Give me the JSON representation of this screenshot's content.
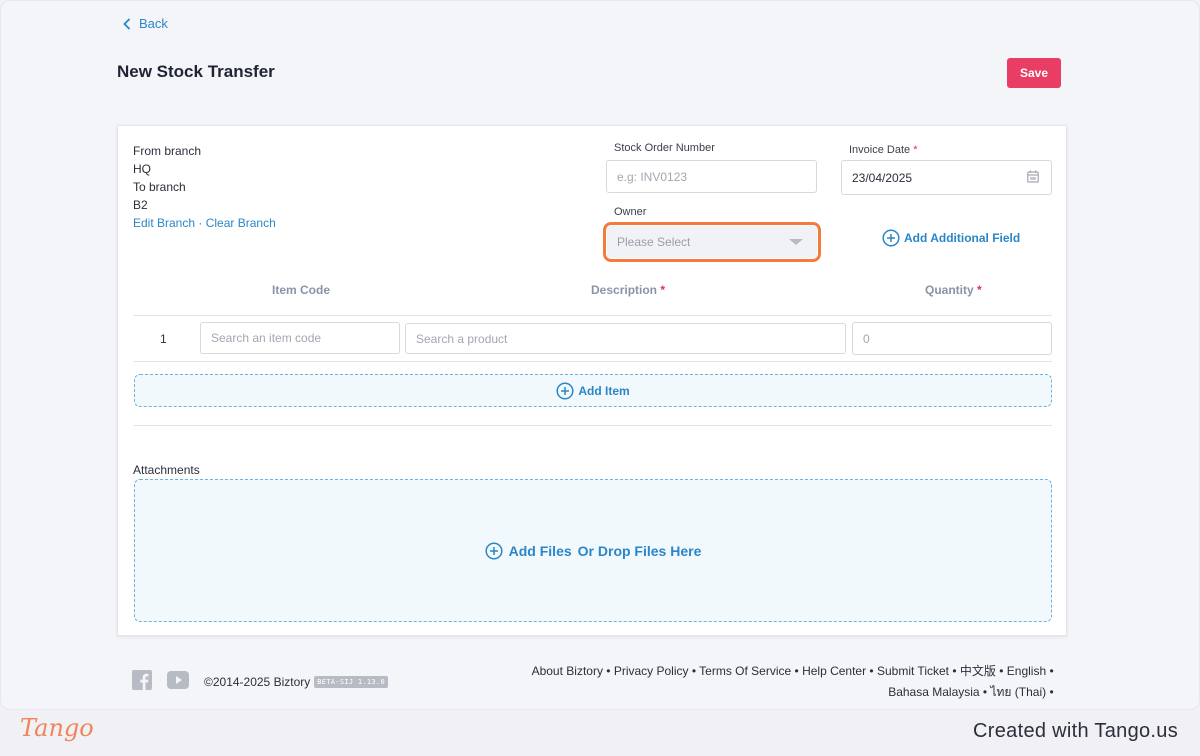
{
  "nav": {
    "back_label": "Back"
  },
  "header": {
    "title": "New Stock Transfer",
    "save_label": "Save"
  },
  "branch": {
    "from_label": "From branch",
    "from_value": "HQ",
    "to_label": "To branch",
    "to_value": "B2",
    "edit_link": "Edit Branch",
    "separator": " · ",
    "clear_link": "Clear Branch"
  },
  "fields": {
    "stock_order_label": "Stock Order Number",
    "stock_order_placeholder": "e.g: INV0123",
    "invoice_date_label": "Invoice Date",
    "invoice_date_value": "23/04/2025",
    "owner_label": "Owner",
    "owner_placeholder": "Please Select",
    "add_field_label": "Add Additional Field",
    "required_mark": "*"
  },
  "table": {
    "headers": {
      "item_code": "Item Code",
      "description": "Description",
      "quantity": "Quantity"
    },
    "rows": [
      {
        "num": "1",
        "item_code_placeholder": "Search an item code",
        "description_placeholder": "Search a product",
        "quantity_placeholder": "0"
      }
    ],
    "add_item_label": "Add Item"
  },
  "attachments": {
    "label": "Attachments",
    "add_files": "Add Files",
    "drop_files": "Or Drop Files Here"
  },
  "footer": {
    "copyright": "©2014-2025 Biztory",
    "version_badge": "BETA-SIJ 1.13.0",
    "links_line1": [
      "About Biztory",
      "Privacy Policy",
      "Terms Of Service",
      "Help Center",
      "Submit Ticket",
      "中文版",
      "English"
    ],
    "links_line2": [
      "Bahasa Malaysia",
      "ไทย (Thai)"
    ],
    "separator": " • "
  },
  "tango": {
    "logo": "Tango",
    "credit": "Created with Tango.us"
  },
  "colors": {
    "accent": "#2a86c8",
    "save": "#ea3d65",
    "highlight": "#f47a3e",
    "required": "#e0334f"
  }
}
